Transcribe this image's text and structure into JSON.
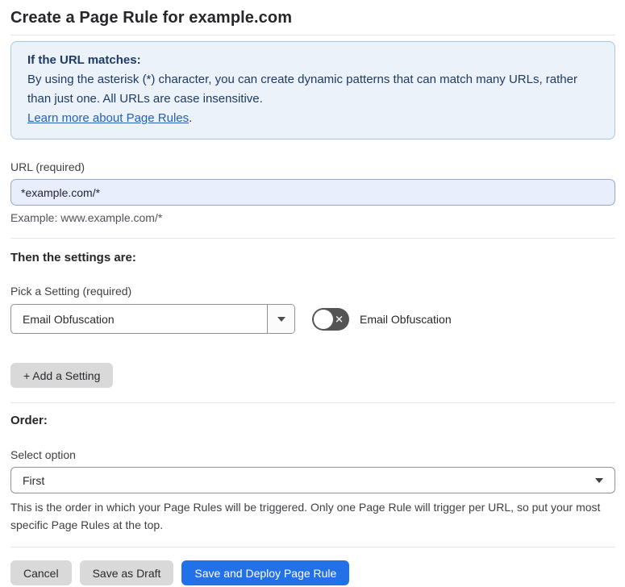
{
  "page": {
    "title": "Create a Page Rule for example.com"
  },
  "info_box": {
    "heading": "If the URL matches:",
    "body": "By using the asterisk (*) character, you can create dynamic patterns that can match many URLs, rather than just one. All URLs are case insensitive.",
    "link": "Learn more about Page Rules",
    "link_suffix": "."
  },
  "url_section": {
    "label": "URL (required)",
    "value": "*example.com/*",
    "example": "Example: www.example.com/*"
  },
  "settings_section": {
    "heading": "Then the settings are:",
    "picker_label": "Pick a Setting (required)",
    "selected_setting": "Email Obfuscation",
    "toggle": {
      "state": "off",
      "x_glyph": "✕",
      "label": "Email Obfuscation"
    },
    "add_button_label": "+ Add a Setting"
  },
  "order_section": {
    "heading": "Order:",
    "select_label": "Select option",
    "selected_option": "First",
    "help": "This is the order in which your Page Rules will be triggered. Only one Page Rule will trigger per URL, so put your most specific Page Rules at the top."
  },
  "footer": {
    "cancel_label": "Cancel",
    "save_draft_label": "Save as Draft",
    "save_deploy_label": "Save and Deploy Page Rule"
  },
  "colors": {
    "info_background": "#EBF2FA",
    "info_border": "#A6C6E1",
    "info_text": "#1E3A66",
    "link": "#2262B8",
    "url_input_background": "#E8EEFB",
    "url_input_border": "#9AA7C0",
    "primary_button": "#2371E9",
    "gray_button": "#D9D9D9",
    "toggle_off_background": "#545454"
  }
}
